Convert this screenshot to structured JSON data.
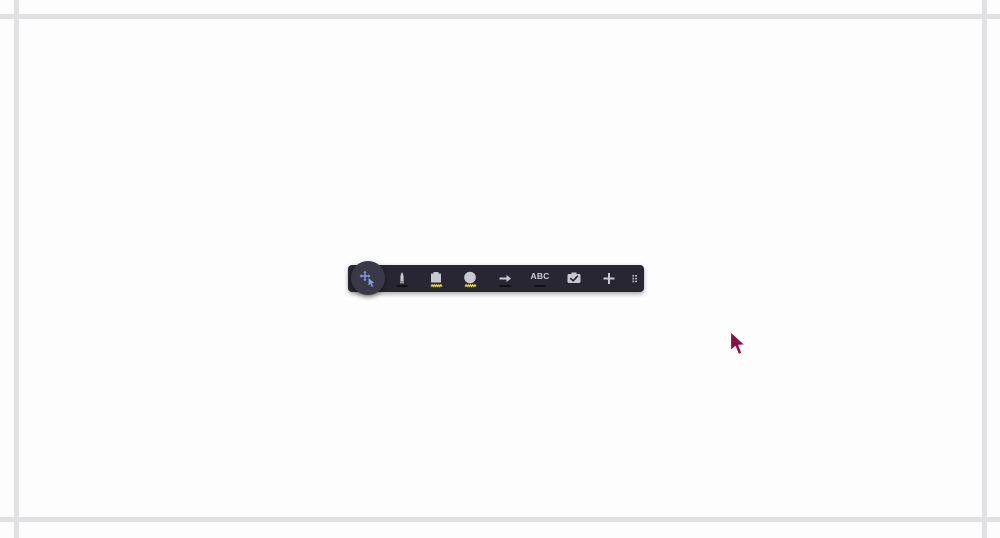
{
  "colors": {
    "canvas_background": "#fdfdfe",
    "frame_lines": "#e1e1e3",
    "toolbar_background": "#272632",
    "mode_knob": "#393948",
    "accent_blue": "#7f9fe4",
    "accent_yellow": "#f0d83a",
    "icon_gray": "#c8c8d0",
    "cursor": "#8a0f47"
  },
  "toolbar": {
    "tools": [
      {
        "id": "select-move",
        "icon": "move-select-icon",
        "active": true
      },
      {
        "id": "marker",
        "icon": "marker-icon",
        "underline_color": "#111111"
      },
      {
        "id": "highlighter",
        "icon": "highlighter-icon",
        "underline_color": "#f0d83a",
        "underline_style": "wavy"
      },
      {
        "id": "shape",
        "icon": "circle-icon",
        "underline_color": "#f0d83a",
        "underline_style": "wavy"
      },
      {
        "id": "arrow",
        "icon": "arrow-icon",
        "underline_color": "#111111"
      },
      {
        "id": "text",
        "icon": "text-icon",
        "label": "ABC",
        "underline_color": "#111111"
      },
      {
        "id": "stamp",
        "icon": "stamp-check-icon"
      },
      {
        "id": "add",
        "icon": "plus-icon"
      },
      {
        "id": "drag",
        "icon": "drag-handle-icon"
      }
    ]
  }
}
